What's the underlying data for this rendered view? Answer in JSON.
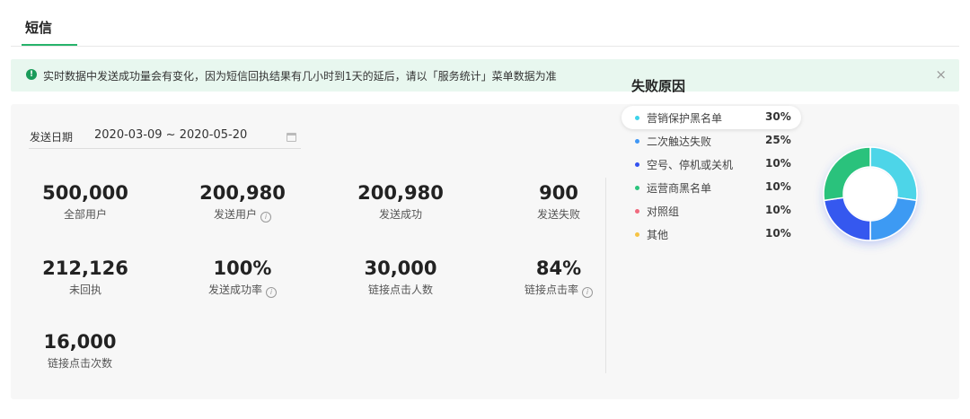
{
  "tabs": [
    {
      "label": "短信",
      "active": true
    }
  ],
  "alert": {
    "text": "实时数据中发送成功量会有变化，因为短信回执结果有几小时到1天的延后，请以「服务统计」菜单数据为准",
    "icon": "info-circle-icon",
    "close_icon": "close-icon"
  },
  "date_filter": {
    "label": "发送日期",
    "value": "2020-03-09 ~ 2020-05-20",
    "icon": "calendar-icon"
  },
  "stats": [
    {
      "value": "500,000",
      "label": "全部用户",
      "info": false
    },
    {
      "value": "200,980",
      "label": "发送用户",
      "info": true
    },
    {
      "value": "200,980",
      "label": "发送成功",
      "info": false
    },
    {
      "value": "900",
      "label": "发送失败",
      "info": false
    },
    {
      "value": "212,126",
      "label": "未回执",
      "info": false
    },
    {
      "value": "100%",
      "label": "发送成功率",
      "info": true
    },
    {
      "value": "30,000",
      "label": "链接点击人数",
      "info": false
    },
    {
      "value": "84%",
      "label": "链接点击率",
      "info": true
    },
    {
      "value": "16,000",
      "label": "链接点击次数",
      "info": false
    }
  ],
  "failure": {
    "title": "失败原因",
    "active_index": 0
  },
  "chart_data": {
    "type": "pie",
    "donut": true,
    "categories": [
      "营销保护黑名单",
      "二次触达失败",
      "空号、停机或关机",
      "运营商黑名单",
      "对照组",
      "其他"
    ],
    "values": [
      30,
      25,
      10,
      10,
      10,
      10
    ],
    "labels": [
      "30%",
      "25%",
      "10%",
      "10%",
      "10%",
      "10%"
    ],
    "colors": [
      "#3ed3ea",
      "#3f97f5",
      "#3352f0",
      "#2bc47d",
      "#f06a7e",
      "#f6c344"
    ],
    "chart_colors": [
      "#4ed5e8",
      "#3c9af3",
      "#3558ef",
      "#2cc27c"
    ],
    "chart_values": [
      30,
      25,
      25,
      30
    ]
  }
}
